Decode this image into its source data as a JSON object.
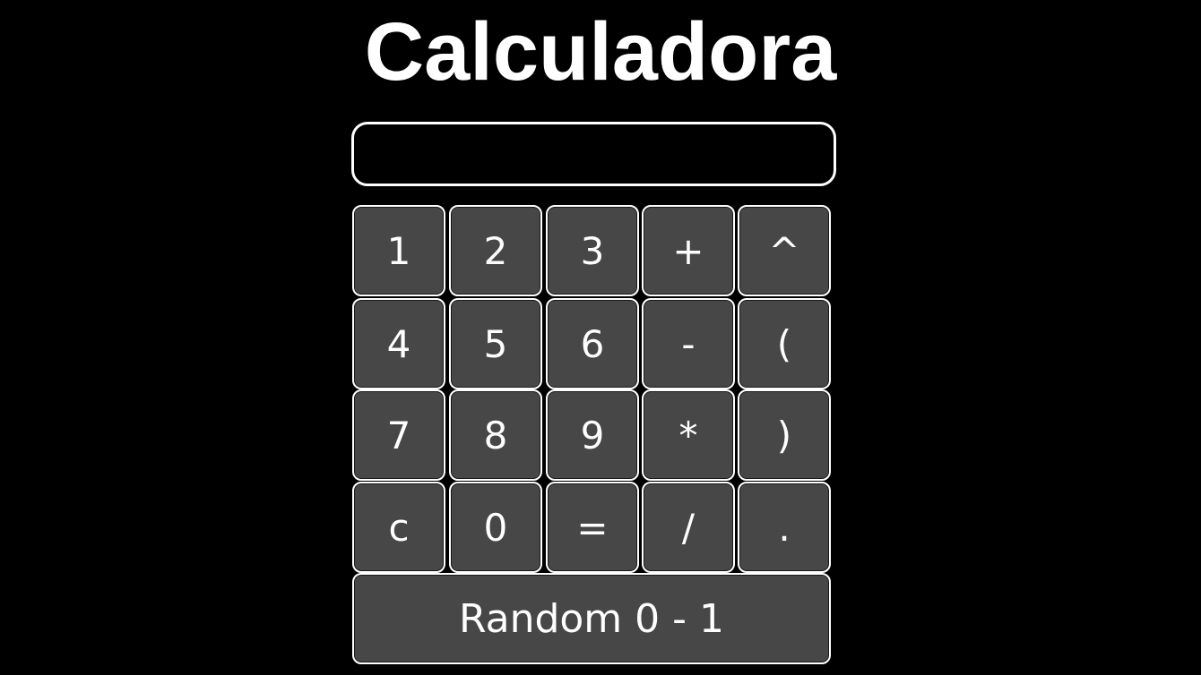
{
  "header": {
    "title": "Calculadora"
  },
  "display": {
    "value": "",
    "placeholder": ""
  },
  "keys": {
    "k1": "1",
    "k2": "2",
    "k3": "3",
    "plus": "+",
    "power": "^",
    "k4": "4",
    "k5": "5",
    "k6": "6",
    "minus": "-",
    "open_paren": "(",
    "k7": "7",
    "k8": "8",
    "k9": "9",
    "multiply": "*",
    "close_paren": ")",
    "clear": "c",
    "k0": "0",
    "equals": "=",
    "divide": "/",
    "decimal": ".",
    "random": "Random 0 - 1"
  },
  "colors": {
    "background": "#000000",
    "key_fill": "#474747",
    "border": "#ffffff",
    "text": "#ffffff"
  }
}
